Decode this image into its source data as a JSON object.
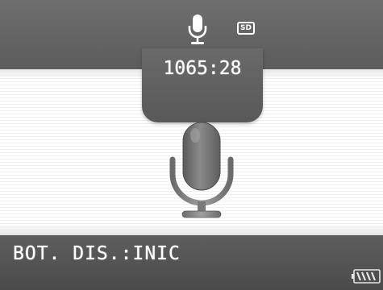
{
  "header": {
    "mic_icon": "microphone-icon",
    "storage_badge": "SD",
    "remaining_time": "1065:28"
  },
  "main": {
    "mic_icon": "microphone-icon"
  },
  "footer": {
    "status_text": "BOT. DIS.:INIC",
    "battery_icon": "battery-icon"
  },
  "colors": {
    "bar": "#5e5e5e",
    "mic_body": "#747474",
    "text": "#ffffff"
  }
}
